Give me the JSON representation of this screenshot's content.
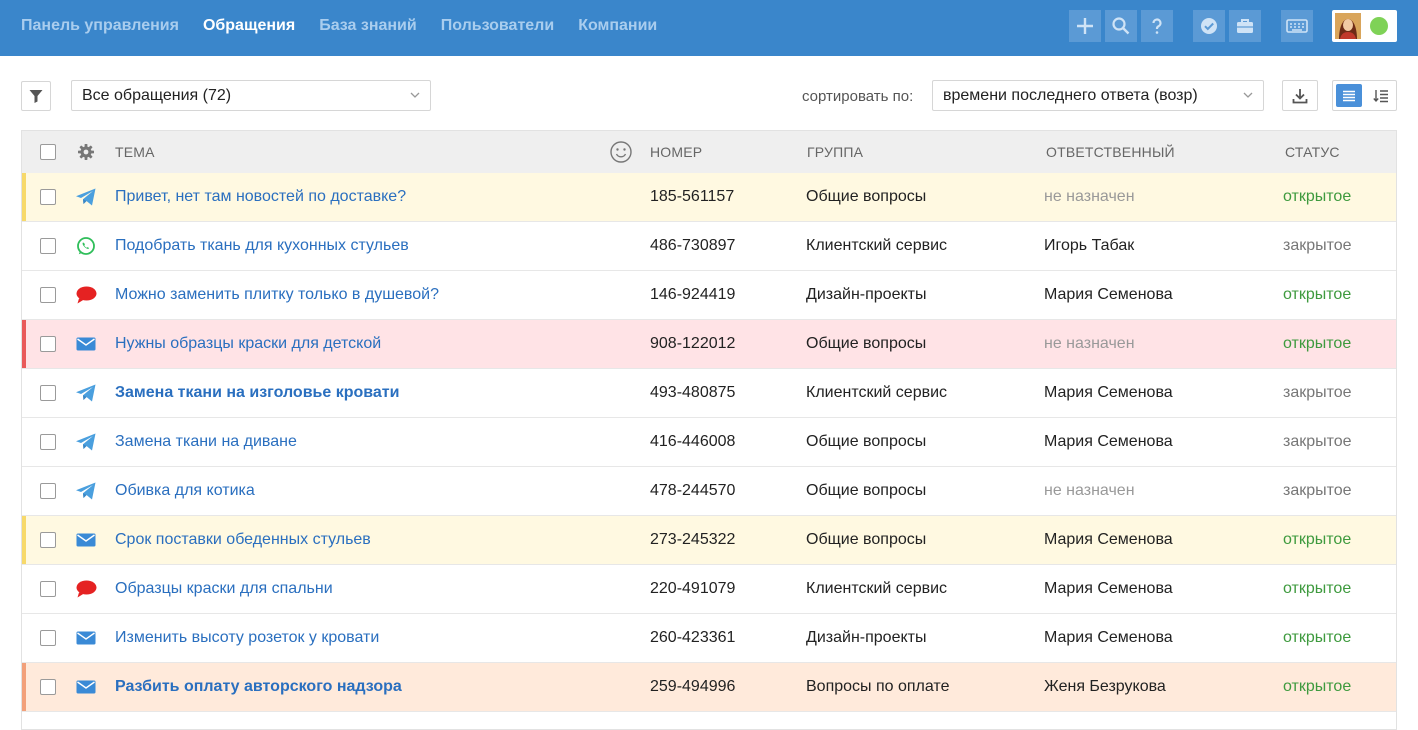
{
  "nav": {
    "items": [
      {
        "label": "Панель управления",
        "active": false
      },
      {
        "label": "Обращения",
        "active": true
      },
      {
        "label": "База знаний",
        "active": false
      },
      {
        "label": "Пользователи",
        "active": false
      },
      {
        "label": "Компании",
        "active": false
      }
    ]
  },
  "toolbar": {
    "view_select": "Все обращения (72)",
    "sort_label": "сортировать по:",
    "sort_select": "времени последнего ответа (возр)"
  },
  "table": {
    "headers": {
      "subject": "ТЕМА",
      "number": "НОМЕР",
      "group": "ГРУППА",
      "assignee": "ОТВЕТСТВЕННЫЙ",
      "status": "СТАТУС"
    },
    "rows": [
      {
        "channel": "telegram-icon",
        "subject": "Привет, нет там новостей по доставке?",
        "bold": false,
        "number": "185-561157",
        "group": "Общие вопросы",
        "assignee": "не назначен",
        "unassigned": true,
        "status": "открытое",
        "open": true,
        "bg": "#fff9e1",
        "bar": "#f7d96a"
      },
      {
        "channel": "whatsapp-icon",
        "subject": "Подобрать ткань для кухонных стульев",
        "bold": false,
        "number": "486-730897",
        "group": "Клиентский сервис",
        "assignee": "Игорь Табак",
        "unassigned": false,
        "status": "закрытое",
        "open": false,
        "bg": "#ffffff",
        "bar": ""
      },
      {
        "channel": "chat-bubble-icon",
        "subject": "Можно заменить плитку только в душевой?",
        "bold": false,
        "number": "146-924419",
        "group": "Дизайн-проекты",
        "assignee": "Мария Семенова",
        "unassigned": false,
        "status": "открытое",
        "open": true,
        "bg": "#ffffff",
        "bar": ""
      },
      {
        "channel": "email-icon",
        "subject": "Нужны образцы краски для детской",
        "bold": false,
        "number": "908-122012",
        "group": "Общие вопросы",
        "assignee": "не назначен",
        "unassigned": true,
        "status": "открытое",
        "open": true,
        "bg": "#ffe3e6",
        "bar": "#e95a5a"
      },
      {
        "channel": "telegram-icon",
        "subject": "Замена ткани на изголовье кровати",
        "bold": true,
        "number": "493-480875",
        "group": "Клиентский сервис",
        "assignee": "Мария Семенова",
        "unassigned": false,
        "status": "закрытое",
        "open": false,
        "bg": "#ffffff",
        "bar": ""
      },
      {
        "channel": "telegram-icon",
        "subject": "Замена ткани на диване",
        "bold": false,
        "number": "416-446008",
        "group": "Общие вопросы",
        "assignee": "Мария Семенова",
        "unassigned": false,
        "status": "закрытое",
        "open": false,
        "bg": "#ffffff",
        "bar": ""
      },
      {
        "channel": "telegram-icon",
        "subject": "Обивка для котика",
        "bold": false,
        "number": "478-244570",
        "group": "Общие вопросы",
        "assignee": "не назначен",
        "unassigned": true,
        "status": "закрытое",
        "open": false,
        "bg": "#ffffff",
        "bar": ""
      },
      {
        "channel": "email-icon",
        "subject": "Срок поставки обеденных стульев",
        "bold": false,
        "number": "273-245322",
        "group": "Общие вопросы",
        "assignee": "Мария Семенова",
        "unassigned": false,
        "status": "открытое",
        "open": true,
        "bg": "#fff9e1",
        "bar": "#f7d96a"
      },
      {
        "channel": "chat-bubble-icon",
        "subject": "Образцы краски для спальни",
        "bold": false,
        "number": "220-491079",
        "group": "Клиентский сервис",
        "assignee": "Мария Семенова",
        "unassigned": false,
        "status": "открытое",
        "open": true,
        "bg": "#ffffff",
        "bar": ""
      },
      {
        "channel": "email-icon",
        "subject": "Изменить высоту розеток у кровати",
        "bold": false,
        "number": "260-423361",
        "group": "Дизайн-проекты",
        "assignee": "Мария Семенова",
        "unassigned": false,
        "status": "открытое",
        "open": true,
        "bg": "#ffffff",
        "bar": ""
      },
      {
        "channel": "email-icon",
        "subject": "Разбить оплату авторского надзора",
        "bold": true,
        "number": "259-494996",
        "group": "Вопросы по оплате",
        "assignee": "Женя Безрукова",
        "unassigned": false,
        "status": "открытое",
        "open": true,
        "bg": "#ffeadb",
        "bar": "#f2a07a"
      }
    ]
  },
  "colors": {
    "topbar": "#3a86cb",
    "link": "#2a6fbf",
    "status_open": "#3e9a3e",
    "status_closed": "#777777"
  }
}
